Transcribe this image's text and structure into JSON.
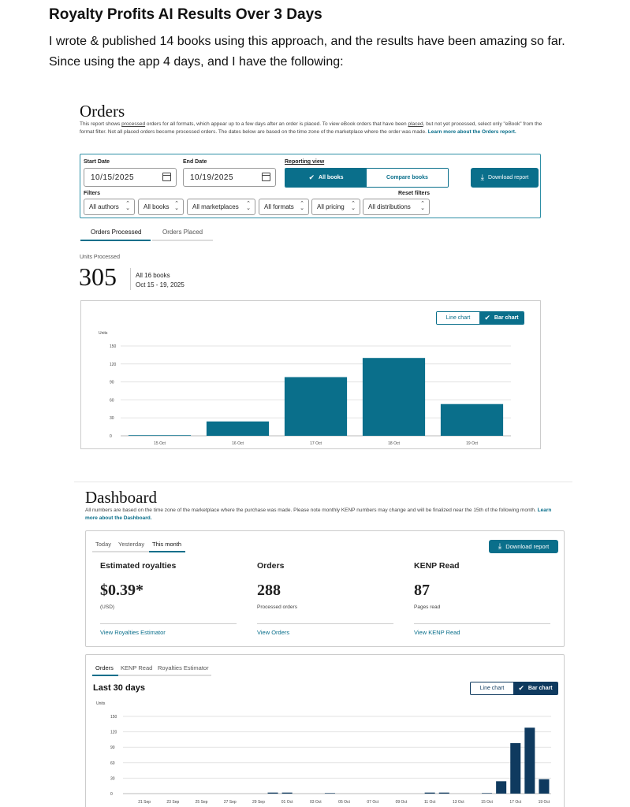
{
  "intro": {
    "title": "Royalty Profits AI Results Over 3 Days",
    "line1": "I wrote & published 14 books using this approach, and the results have been amazing so far.",
    "line2": "Since using the app 4 days, and I have the following:"
  },
  "orders": {
    "heading": "Orders",
    "desc_a": "This report shows ",
    "desc_processed": "processed",
    "desc_b": " orders for all formats, which appear up to a few days after an order is placed. To view eBook orders that have been ",
    "desc_placed": "placed",
    "desc_c": ", but not yet processed, select only \"eBook\" from the format filter. Not all placed orders become processed orders. The dates below are based on the time zone of the marketplace where the order was made. ",
    "desc_link": "Learn more about the Orders report.",
    "start_label": "Start Date",
    "start_value": "10/15/2025",
    "end_label": "End Date",
    "end_value": "10/19/2025",
    "reporting_label": "Reporting view",
    "view_all": "All books",
    "view_compare": "Compare books",
    "download": "Download report",
    "filters_label": "Filters",
    "reset": "Reset filters",
    "filters": [
      "All authors",
      "All books",
      "All marketplaces",
      "All formats",
      "All pricing",
      "All distributions"
    ],
    "tab_processed": "Orders Processed",
    "tab_placed": "Orders Placed",
    "units_label": "Units Processed",
    "units_value": "305",
    "units_books": "All 16 books",
    "units_range": "Oct 15 - 19, 2025",
    "toggle_line": "Line chart",
    "toggle_bar": "Bar chart"
  },
  "dashboard": {
    "heading": "Dashboard",
    "desc": "All numbers are based on the time zone of the marketplace where the purchase was made. Please note monthly KENP numbers may change and will be finalized near the 15th of the following month. ",
    "desc_link": "Learn more about the Dashboard.",
    "tabs": [
      "Today",
      "Yesterday",
      "This month"
    ],
    "download": "Download report",
    "metrics": [
      {
        "label": "Estimated royalties",
        "value": "$0.39*",
        "sub": "(USD)",
        "link": "View Royalties Estimator"
      },
      {
        "label": "Orders",
        "value": "288",
        "sub": "Processed orders",
        "link": "View Orders"
      },
      {
        "label": "KENP Read",
        "value": "87",
        "sub": "Pages read",
        "link": "View KENP Read"
      }
    ],
    "chart_tabs": [
      "Orders",
      "KENP Read",
      "Royalties Estimator"
    ],
    "last30": "Last 30 days",
    "toggle_line": "Line chart",
    "toggle_bar": "Bar chart"
  },
  "colors": {
    "teal": "#0a6f8b",
    "navy": "#0f3a5f"
  },
  "icons": {
    "calendar": "calendar-icon",
    "check": "check-icon",
    "download": "download-icon",
    "updown": "up-down-chevron-icon"
  },
  "chart_data": [
    {
      "type": "bar",
      "ylabel": "Units",
      "categories": [
        "15 Oct",
        "16 Oct",
        "17 Oct",
        "18 Oct",
        "19 Oct"
      ],
      "values": [
        1,
        24,
        98,
        130,
        53
      ],
      "yticks": [
        0,
        30,
        60,
        90,
        120,
        150
      ],
      "ylim": [
        0,
        150
      ],
      "grid": true
    },
    {
      "type": "bar",
      "ylabel": "Units",
      "tick_labels": [
        "21 Sep",
        "23 Sep",
        "25 Sep",
        "27 Sep",
        "29 Sep",
        "01 Oct",
        "03 Oct",
        "05 Oct",
        "07 Oct",
        "09 Oct",
        "11 Oct",
        "13 Oct",
        "15 Oct",
        "17 Oct",
        "19 Oct"
      ],
      "x": [
        "20 Sep",
        "21 Sep",
        "22 Sep",
        "23 Sep",
        "24 Sep",
        "25 Sep",
        "26 Sep",
        "27 Sep",
        "28 Sep",
        "29 Sep",
        "30 Sep",
        "01 Oct",
        "02 Oct",
        "03 Oct",
        "04 Oct",
        "05 Oct",
        "06 Oct",
        "07 Oct",
        "08 Oct",
        "09 Oct",
        "10 Oct",
        "11 Oct",
        "12 Oct",
        "13 Oct",
        "14 Oct",
        "15 Oct",
        "16 Oct",
        "17 Oct",
        "18 Oct",
        "19 Oct"
      ],
      "values": [
        0,
        0,
        0,
        0,
        0,
        0,
        0,
        0,
        0,
        0,
        2,
        2,
        0,
        0,
        1,
        0,
        0,
        0,
        0,
        0,
        0,
        2,
        2,
        0,
        0,
        1,
        24,
        98,
        128,
        28
      ],
      "yticks": [
        0,
        30,
        60,
        90,
        120,
        150
      ],
      "ylim": [
        0,
        150
      ],
      "grid": true
    }
  ]
}
